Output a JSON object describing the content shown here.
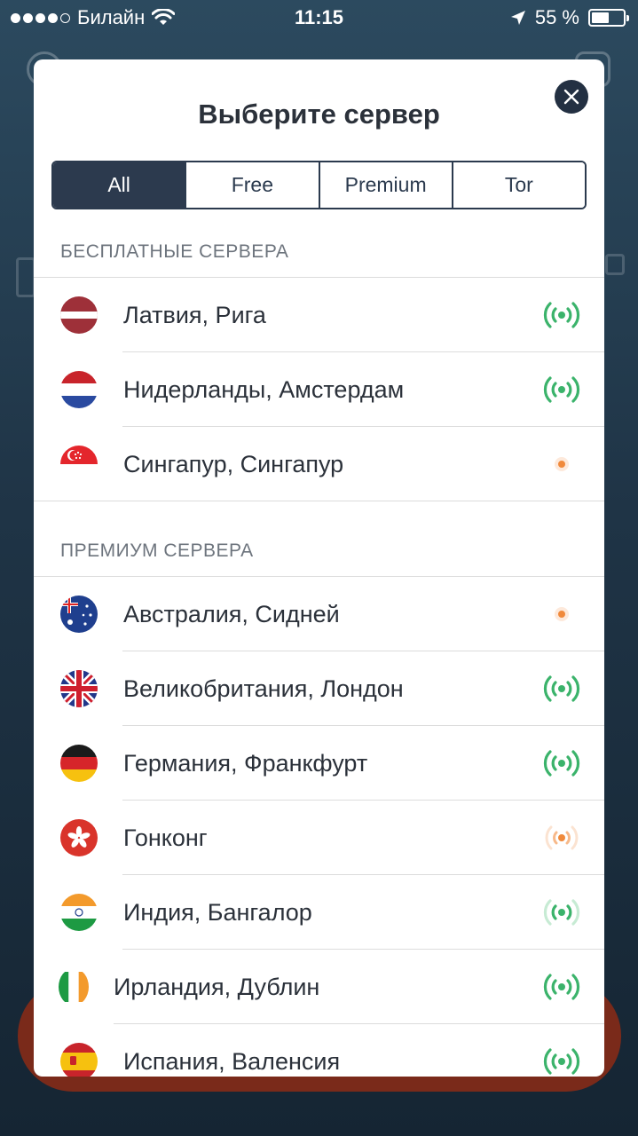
{
  "status_bar": {
    "carrier": "Билайн",
    "time": "11:15",
    "battery": "55 %",
    "battery_level": 0.55
  },
  "modal": {
    "title": "Выберите сервер",
    "tabs": [
      {
        "label": "All",
        "active": true
      },
      {
        "label": "Free",
        "active": false
      },
      {
        "label": "Premium",
        "active": false
      },
      {
        "label": "Tor",
        "active": false
      }
    ],
    "free_section": {
      "header": "БЕСПЛАТНЫЕ СЕРВЕРА",
      "servers": [
        {
          "label": "Латвия, Рига",
          "flag": "latvia-flag-icon",
          "signal": "good"
        },
        {
          "label": "Нидерланды, Амстердам",
          "flag": "netherlands-flag-icon",
          "signal": "good"
        },
        {
          "label": "Сингапур, Сингапур",
          "flag": "singapore-flag-icon",
          "signal": "weak"
        }
      ]
    },
    "premium_section": {
      "header": "ПРЕМИУМ СЕРВЕРА",
      "servers": [
        {
          "label": "Австралия, Сидней",
          "flag": "australia-flag-icon",
          "signal": "weak"
        },
        {
          "label": "Великобритания, Лондон",
          "flag": "uk-flag-icon",
          "signal": "good"
        },
        {
          "label": "Германия, Франкфурт",
          "flag": "germany-flag-icon",
          "signal": "good"
        },
        {
          "label": "Гонконг",
          "flag": "hongkong-flag-icon",
          "signal": "medium"
        },
        {
          "label": "Индия, Бангалор",
          "flag": "india-flag-icon",
          "signal": "medium-good"
        },
        {
          "label": "Ирландия, Дублин",
          "flag": "ireland-flag-icon",
          "signal": "good"
        },
        {
          "label": "Испания, Валенсия",
          "flag": "spain-flag-icon",
          "signal": "good"
        }
      ]
    }
  },
  "colors": {
    "accent": "#2c3a4e",
    "signal_good": "#3bb36b",
    "signal_weak": "#f08a3c",
    "background_button": "#7a2a1a"
  }
}
